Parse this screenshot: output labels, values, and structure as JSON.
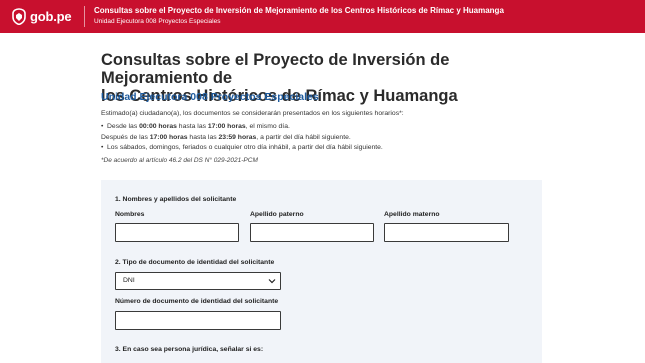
{
  "header": {
    "logo_text": "gob.pe",
    "title": "Consultas sobre el Proyecto de Inversión de Mejoramiento de los Centros Históricos de Rímac y Huamanga",
    "subtitle": "Unidad Ejecutora 008 Proyectos Especiales",
    "brand_color": "#c8102e"
  },
  "main": {
    "title_line1": "Consultas sobre el Proyecto de Inversión de Mejoramiento de",
    "title_line2": "los Centros Históricos de Rímac y Huamanga",
    "subtitle": "Unidad Ejecutora 008 Proyectos Especiales",
    "intro": "Estimado(a) ciudadano(a), los documentos se considerarán presentados en los siguientes horarios*:",
    "schedule": [
      {
        "pre": "Desde las ",
        "b1": "00:00 horas",
        "mid": " hasta las ",
        "b2": "17:00 horas",
        "post": ", el mismo día."
      },
      {
        "pre": "Después de las ",
        "b1": "17:00 horas",
        "mid": " hasta las ",
        "b2": "23:59 horas",
        "post": ", a partir del día hábil siguiente."
      },
      {
        "pre": "Los sábados, domingos, feriados o cualquier otro día inhábil, a partir del día hábil siguiente.",
        "b1": "",
        "mid": "",
        "b2": "",
        "post": ""
      }
    ],
    "note": "*De acuerdo al artículo 46.2 del DS N° 029-2021-PCM"
  },
  "form": {
    "section1": "1. Nombres y apellidos del solicitante",
    "nombres_label": "Nombres",
    "nombres_value": "",
    "paterno_label": "Apellido paterno",
    "paterno_value": "",
    "materno_label": "Apellido materno",
    "materno_value": "",
    "section2": "2. Tipo de documento de identidad del solicitante",
    "doc_type_selected": "DNI",
    "doc_number_label": "Número de documento de identidad del solicitante",
    "doc_number_value": "",
    "section3": "3. En caso sea persona jurídica, señalar si es:"
  },
  "icons": {
    "logo": "peru-shield-icon",
    "select_arrow": "chevron-down-icon"
  }
}
